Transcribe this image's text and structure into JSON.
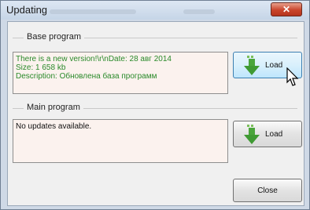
{
  "window": {
    "title": "Updating",
    "close_glyph": "✕"
  },
  "base_program": {
    "group_label": "Base program",
    "status_lines": "There is a new version!\\r\\nDate: 28 авг 2014\nSize: 1 658 kb\nDescription: Обновлена база программ",
    "load_label": "Load"
  },
  "main_program": {
    "group_label": "Main program",
    "status_text": "No updates available.",
    "load_label": "Load"
  },
  "close_label": "Close",
  "icons": {
    "load": "download-arrow-icon",
    "pointer": "mouse-cursor-icon"
  },
  "colors": {
    "status_green": "#2a8a2a",
    "textbox_bg": "#fbf2ee"
  }
}
